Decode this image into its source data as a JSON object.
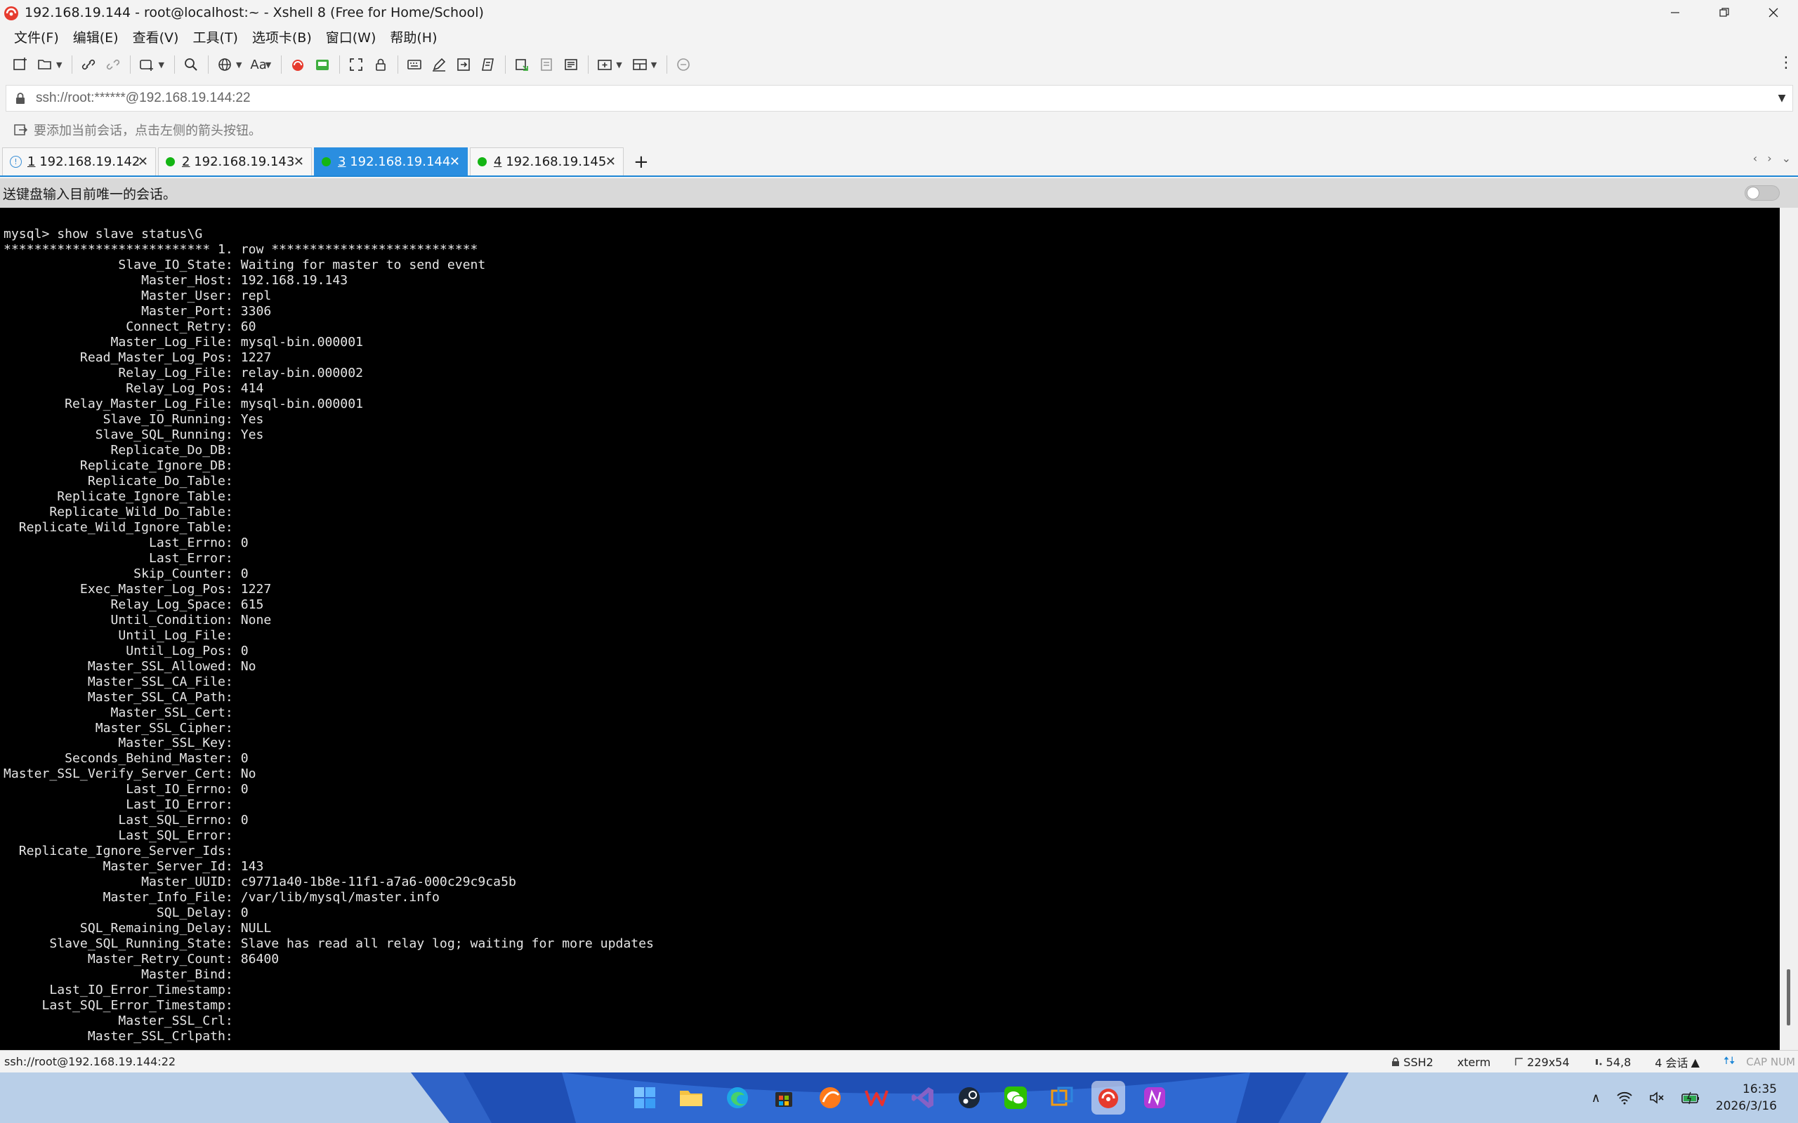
{
  "window": {
    "title": "192.168.19.144 - root@localhost:~ - Xshell 8 (Free for Home/School)"
  },
  "menu": [
    "文件(F)",
    "编辑(E)",
    "查看(V)",
    "工具(T)",
    "选项卡(B)",
    "窗口(W)",
    "帮助(H)"
  ],
  "toolbar": {
    "font_label": "Aa"
  },
  "address": {
    "value": "ssh://root:******@192.168.19.144:22"
  },
  "hint": {
    "text": "要添加当前会话，点击左侧的箭头按钮。"
  },
  "tabs": [
    {
      "num": "1",
      "host": "192.168.19.142",
      "status": "info",
      "active": false
    },
    {
      "num": "2",
      "host": "192.168.19.143",
      "status": "connected",
      "active": false
    },
    {
      "num": "3",
      "host": "192.168.19.144",
      "status": "connected",
      "active": true
    },
    {
      "num": "4",
      "host": "192.168.19.145",
      "status": "connected",
      "active": false
    }
  ],
  "send_bar": {
    "text": "送键盘输入目前唯一的会话。"
  },
  "terminal": {
    "lines": [
      "mysql> show slave status\\G",
      "*************************** 1. row ***************************",
      "               Slave_IO_State: Waiting for master to send event",
      "                  Master_Host: 192.168.19.143",
      "                  Master_User: repl",
      "                  Master_Port: 3306",
      "                Connect_Retry: 60",
      "              Master_Log_File: mysql-bin.000001",
      "          Read_Master_Log_Pos: 1227",
      "               Relay_Log_File: relay-bin.000002",
      "                Relay_Log_Pos: 414",
      "        Relay_Master_Log_File: mysql-bin.000001",
      "             Slave_IO_Running: Yes",
      "            Slave_SQL_Running: Yes",
      "              Replicate_Do_DB: ",
      "          Replicate_Ignore_DB: ",
      "           Replicate_Do_Table: ",
      "       Replicate_Ignore_Table: ",
      "      Replicate_Wild_Do_Table: ",
      "  Replicate_Wild_Ignore_Table: ",
      "                   Last_Errno: 0",
      "                   Last_Error: ",
      "                 Skip_Counter: 0",
      "          Exec_Master_Log_Pos: 1227",
      "              Relay_Log_Space: 615",
      "              Until_Condition: None",
      "               Until_Log_File: ",
      "                Until_Log_Pos: 0",
      "           Master_SSL_Allowed: No",
      "           Master_SSL_CA_File: ",
      "           Master_SSL_CA_Path: ",
      "              Master_SSL_Cert: ",
      "            Master_SSL_Cipher: ",
      "               Master_SSL_Key: ",
      "        Seconds_Behind_Master: 0",
      "Master_SSL_Verify_Server_Cert: No",
      "                Last_IO_Errno: 0",
      "                Last_IO_Error: ",
      "               Last_SQL_Errno: 0",
      "               Last_SQL_Error: ",
      "  Replicate_Ignore_Server_Ids: ",
      "             Master_Server_Id: 143",
      "                  Master_UUID: c9771a40-1b8e-11f1-a7a6-000c29c9ca5b",
      "             Master_Info_File: /var/lib/mysql/master.info",
      "                    SQL_Delay: 0",
      "          SQL_Remaining_Delay: NULL",
      "      Slave_SQL_Running_State: Slave has read all relay log; waiting for more updates",
      "           Master_Retry_Count: 86400",
      "                  Master_Bind: ",
      "      Last_IO_Error_Timestamp: ",
      "     Last_SQL_Error_Timestamp: ",
      "               Master_SSL_Crl: ",
      "           Master_SSL_Crlpath: "
    ]
  },
  "status_bar": {
    "path": "ssh://root@192.168.19.144:22",
    "protocol": "SSH2",
    "term": "xterm",
    "size": "229x54",
    "cursor": "54,8",
    "sessions": "4 会话",
    "caps": "CAP NUM"
  },
  "taskbar": {
    "time": "16:35",
    "date": "2026/3/16"
  },
  "colors": {
    "accent": "#2a8ee0",
    "terminal_bg": "#000000",
    "terminal_fg": "#e6e6e6",
    "connected": "#14b514"
  }
}
